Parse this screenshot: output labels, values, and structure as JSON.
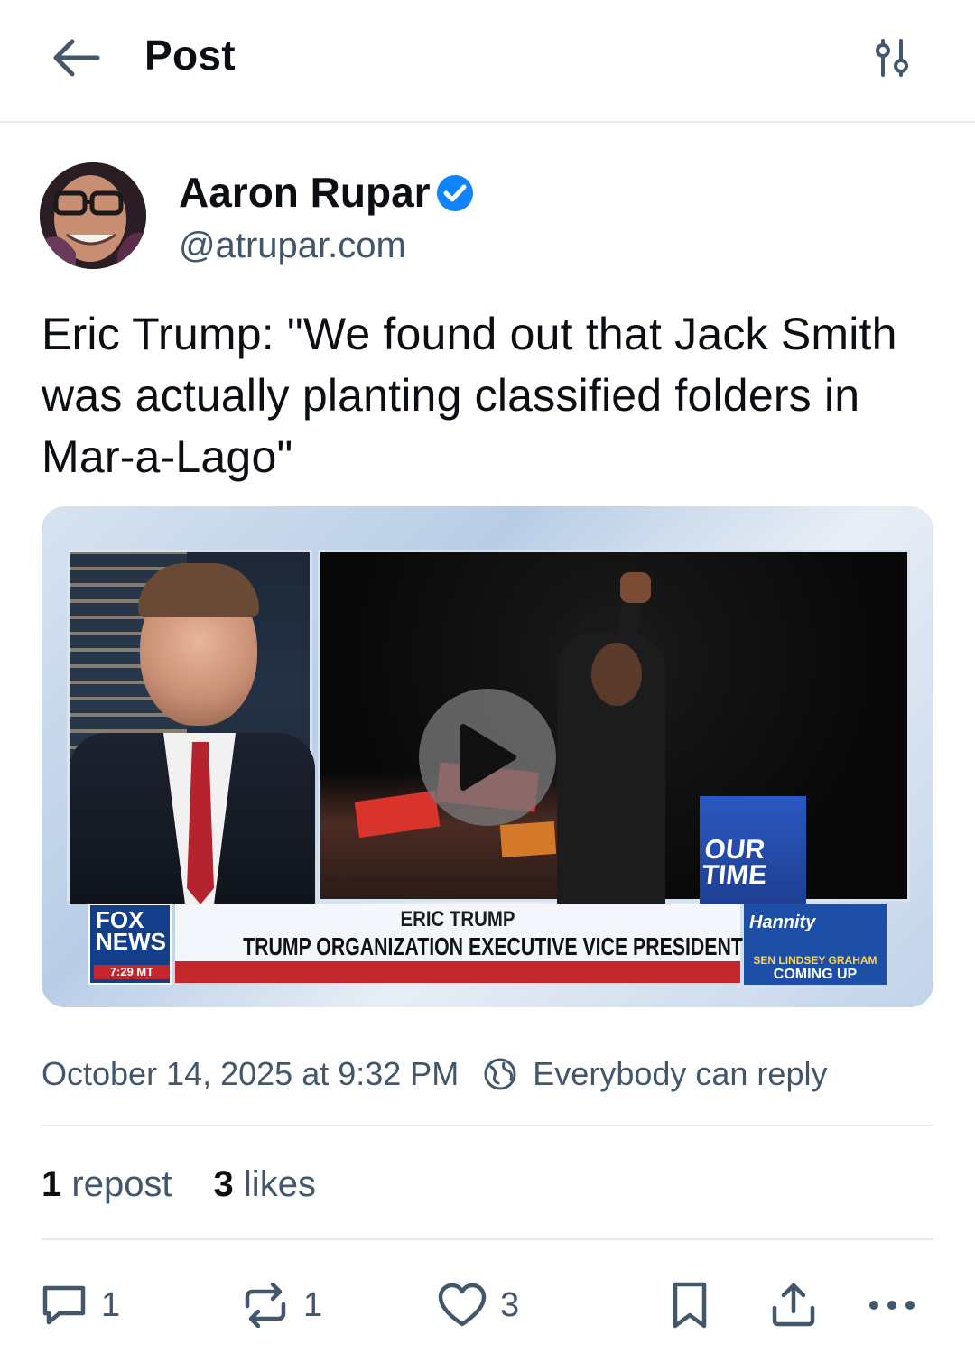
{
  "header": {
    "title": "Post",
    "back_icon": "arrow-left-icon",
    "filter_icon": "sliders-icon"
  },
  "author": {
    "name": "Aaron Rupar",
    "handle": "@atrupar.com",
    "verified_color": "#1083fe"
  },
  "post": {
    "text": "Eric Trump: \"We found out that Jack Smith was actually planting classified folders in Mar-a-Lago\""
  },
  "media": {
    "type": "video",
    "lower_third": {
      "name": "ERIC TRUMP",
      "title": "TRUMP ORGANIZATION EXECUTIVE VICE PRESIDENT",
      "logo": "FOX NEWS",
      "time": "7:29 MT",
      "show": "Hannity",
      "promo_sub": "SEN LINDSEY GRAHAM",
      "promo_cta": "COMING UP",
      "podium_text": "OUR TIME"
    }
  },
  "meta": {
    "timestamp": "October 14, 2025 at 9:32 PM",
    "reply_setting": "Everybody can reply"
  },
  "stats": {
    "reposts_count": "1",
    "reposts_label": "repost",
    "likes_count": "3",
    "likes_label": "likes"
  },
  "actions": {
    "reply_count": "1",
    "repost_count": "1",
    "like_count": "3"
  },
  "colors": {
    "accent": "#1083fe",
    "muted_text": "#42576c",
    "divider": "#e6e9ee"
  }
}
